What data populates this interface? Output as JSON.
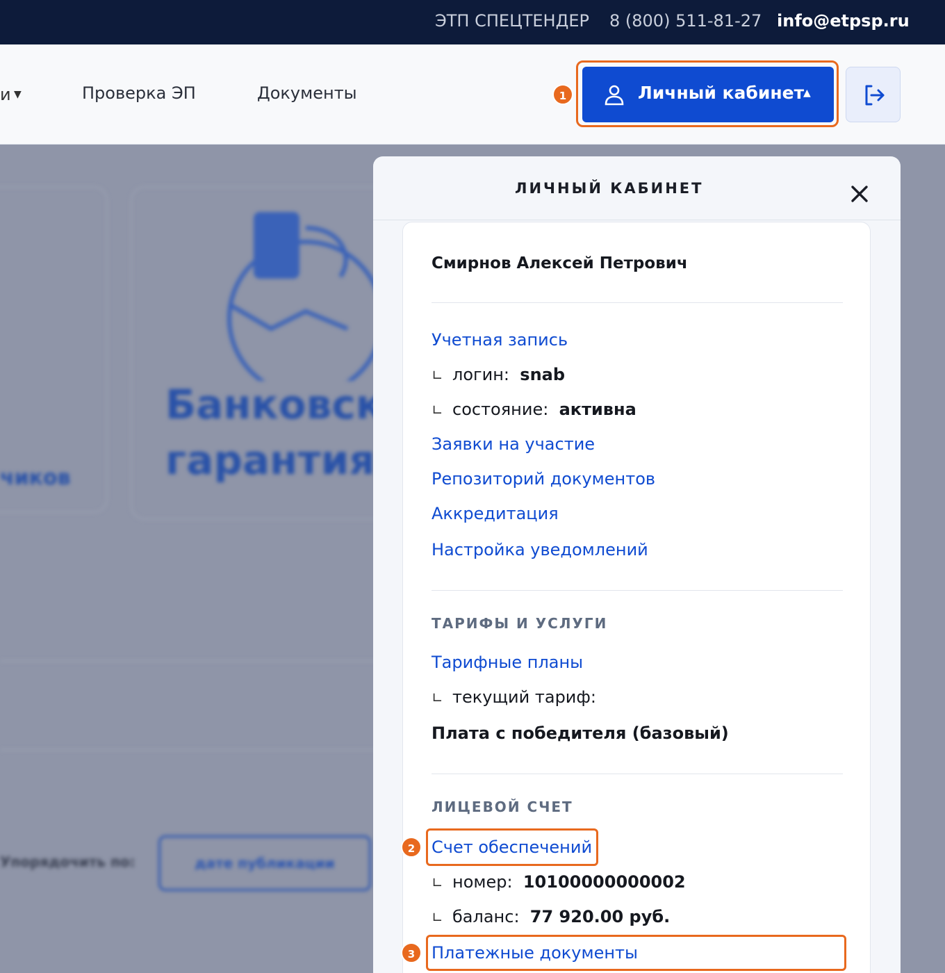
{
  "topbar": {
    "brand": "ЭТП СПЕЦТЕНДЕР",
    "phone": "8 (800) 511-81-27",
    "email": "info@etpsp.ru"
  },
  "nav": {
    "stub": "и",
    "check_ep": "Проверка ЭП",
    "documents": "Документы",
    "cabinet_button": "Личный кабинет"
  },
  "badges": {
    "one": "1",
    "two": "2",
    "three": "3"
  },
  "background": {
    "bank_line1": "Банковская",
    "bank_line2": "гарантия",
    "chikov": "чиков",
    "sort_label": "Упорядочить по:",
    "sort_value": "дате публикации"
  },
  "panel": {
    "title": "ЛИЧНЫЙ КАБИНЕТ",
    "user_name": "Смирнов Алексей Петрович",
    "account_link": "Учетная запись",
    "login_label": "логин:",
    "login_value": "snab",
    "state_label": "состояние:",
    "state_value": "активна",
    "applications_link": "Заявки на участие",
    "repository_link": "Репозиторий документов",
    "accreditation_link": "Аккредитация",
    "notifications_link": "Настройка уведомлений",
    "tariffs_section": "ТАРИФЫ И УСЛУГИ",
    "tariff_plans_link": "Тарифные планы",
    "current_tariff_label": "текущий тариф:",
    "current_tariff_value": "Плата с победителя (базовый)",
    "account_section": "ЛИЦЕВОЙ СЧЕТ",
    "security_account_link": "Счет обеспечений",
    "number_label": "номер:",
    "number_value": "10100000000002",
    "balance_label": "баланс:",
    "balance_value": "77 920.00 руб.",
    "payment_docs_link": "Платежные документы"
  },
  "colors": {
    "accent": "#0f4bd1",
    "highlight": "#e8691e",
    "topbar": "#0d1b3a"
  },
  "icons": [
    "user-icon",
    "logout-icon",
    "close-icon",
    "caret-up-icon",
    "caret-down-icon"
  ]
}
